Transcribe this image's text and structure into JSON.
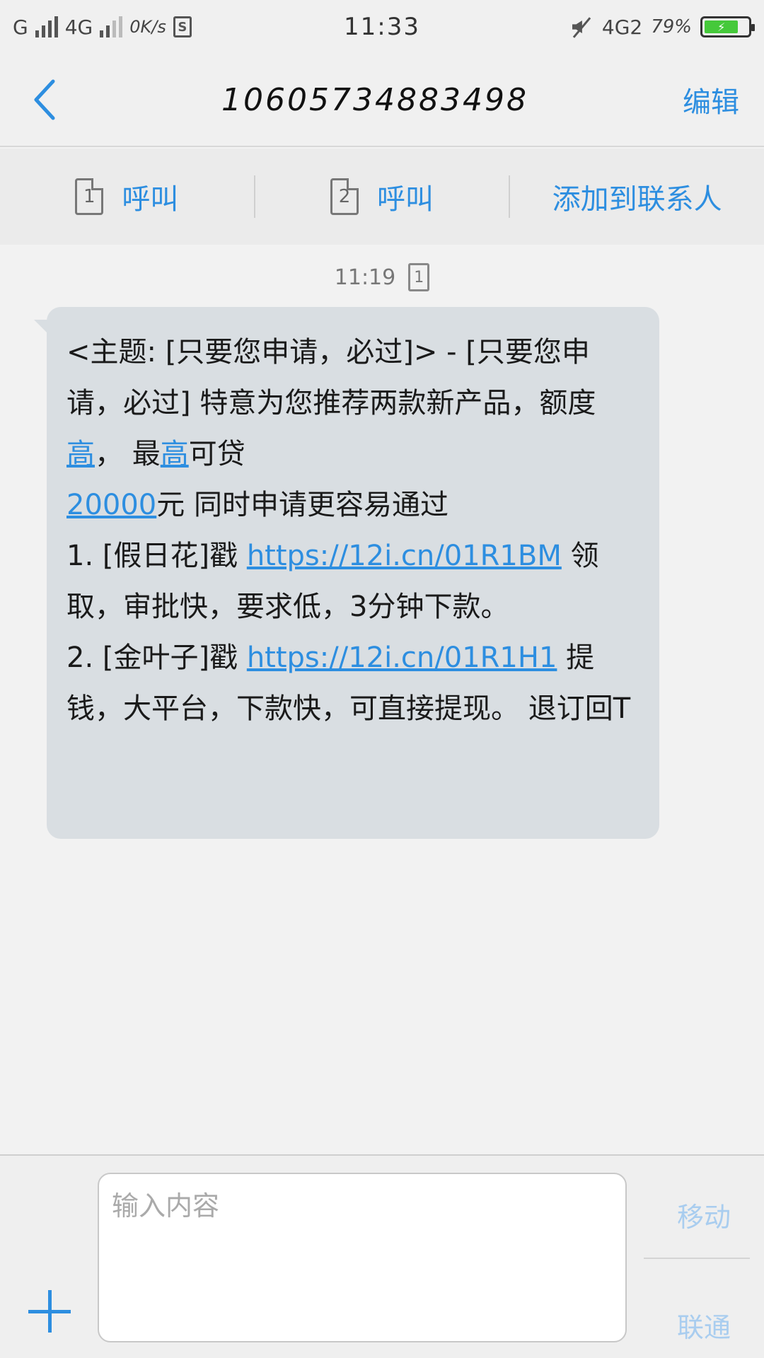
{
  "status_bar": {
    "carrier1": "G",
    "carrier2": "4G",
    "speed": "0K/s",
    "sim_badge": "S",
    "time": "11:33",
    "network2": "4G2",
    "battery": "79%"
  },
  "header": {
    "title": "10605734883498",
    "edit_label": "编辑"
  },
  "actions": {
    "call1_sim": "1",
    "call1_label": "呼叫",
    "call2_sim": "2",
    "call2_label": "呼叫",
    "add_contact_label": "添加到联系人"
  },
  "message": {
    "time": "11:19",
    "sim": "1",
    "part1": "<主题: [只要您申请，必过]> - [只要您申请，必过] 特意为您推荐两款新产品，额度",
    "hl1": "高",
    "part2": "， 最",
    "hl2": "高",
    "part3": "可贷",
    "amount": "20000",
    "part4": "元 同时申请更容易通过",
    "item1_prefix": "1. [假日花]戳 ",
    "item1_link": "https://12i.cn/01R1BM",
    "item1_suffix": " 领取，审批快，要求低，3分钟下款。",
    "item2_prefix": "2. [金叶子]戳 ",
    "item2_link": "https://12i.cn/01R1H1",
    "item2_suffix": " 提钱，大平台，下款快，可直接提现。 退订回T"
  },
  "composer": {
    "placeholder": "输入内容",
    "send_top": "移动",
    "send_bottom": "联通"
  },
  "colors": {
    "accent": "#2d8ee0",
    "bubble": "#d9dee2",
    "battery": "#45c93a"
  }
}
